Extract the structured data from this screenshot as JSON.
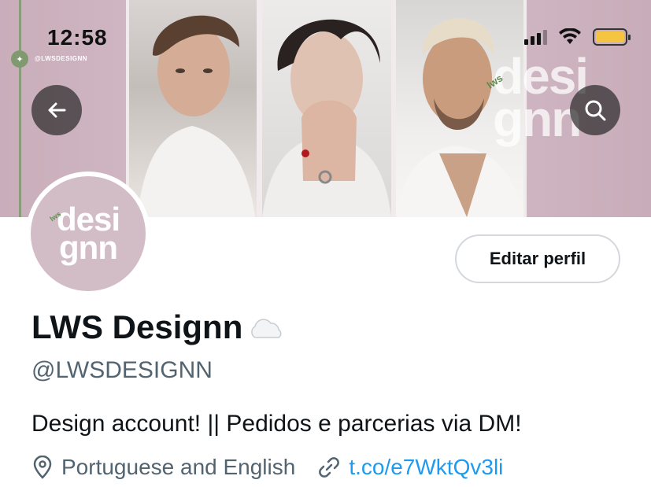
{
  "status_bar": {
    "time": "12:58"
  },
  "banner": {
    "handle_small": "@LWSDESIGNN",
    "watermark_line1": "desi",
    "watermark_line2": "gnn",
    "watermark_tag": "lws"
  },
  "avatar": {
    "line1": "desi",
    "line2": "gnn",
    "tag": "lws"
  },
  "actions": {
    "edit_profile_label": "Editar perfil"
  },
  "profile": {
    "name": "LWS Designn",
    "handle": "@LWSDESIGNN",
    "bio": "Design account! || Pedidos e parcerias via DM!",
    "location": "Portuguese and English",
    "link": "t.co/e7WktQv3li"
  },
  "colors": {
    "accent": "#1d9bf0",
    "banner": "#cdb5c0",
    "battery": "#f5c542"
  }
}
